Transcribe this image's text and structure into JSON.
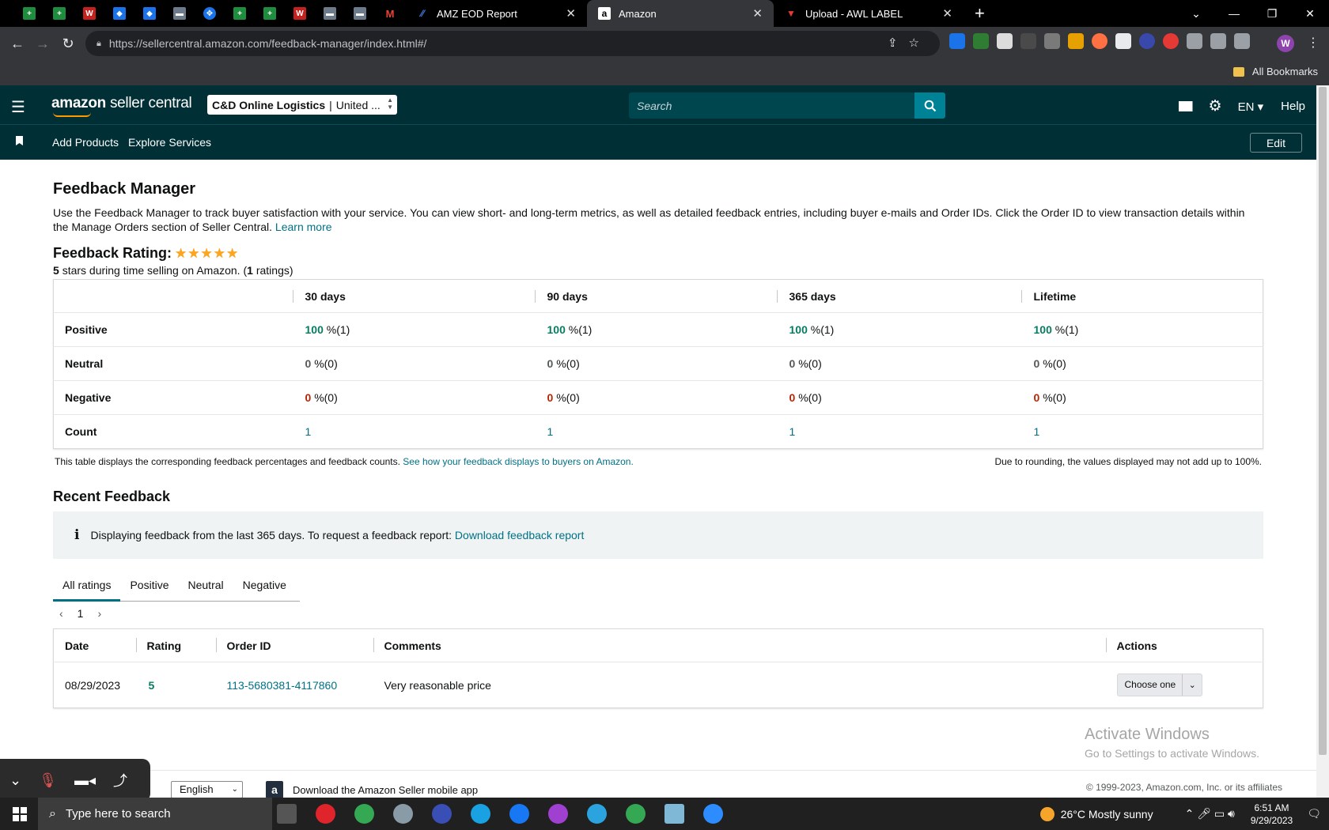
{
  "browser": {
    "tabs": [
      {
        "title": "AMZ EOD Report",
        "active": false
      },
      {
        "title": "Amazon",
        "active": true
      },
      {
        "title": "Upload - AWL LABEL",
        "active": false
      }
    ],
    "url_host": "https://sellercentral.amazon.com",
    "url_path": "/feedback-manager/index.html#/",
    "bookmarks_label": "All Bookmarks",
    "profile_initial": "W"
  },
  "header": {
    "logo_amazon": "amazon",
    "logo_rest": "seller central",
    "account_name": "C&D Online Logistics",
    "account_sep": "|",
    "account_region": "United ...",
    "search_placeholder": "Search",
    "lang": "EN",
    "help": "Help"
  },
  "subnav": {
    "links": [
      "Add Products",
      "Explore Services"
    ],
    "edit": "Edit"
  },
  "page": {
    "title": "Feedback Manager",
    "intro": "Use the Feedback Manager to track buyer satisfaction with your service. You can view short- and long-term metrics, as well as detailed feedback entries, including buyer e-mails and Order IDs. Click the Order ID to view transaction details within the Manage Orders section of Seller Central.",
    "learn_more": "Learn more",
    "rating_title": "Feedback Rating:",
    "stars": "★★★★★",
    "rating_stars_value": "5",
    "rating_stars_text": "stars during time selling on Amazon. (",
    "rating_count": "1",
    "rating_count_suffix": "ratings)"
  },
  "metrics": {
    "columns": [
      "30 days",
      "90 days",
      "365 days",
      "Lifetime"
    ],
    "rows": [
      {
        "label": "Positive",
        "values": [
          "100",
          "100",
          "100",
          "100"
        ],
        "suffix": "%(1)"
      },
      {
        "label": "Neutral",
        "values": [
          "0",
          "0",
          "0",
          "0"
        ],
        "suffix": "%(0)"
      },
      {
        "label": "Negative",
        "values": [
          "0",
          "0",
          "0",
          "0"
        ],
        "suffix": "%(0)"
      },
      {
        "label": "Count",
        "values": [
          "1",
          "1",
          "1",
          "1"
        ],
        "suffix": ""
      }
    ],
    "foot_left": "This table displays the corresponding feedback percentages and feedback counts.",
    "foot_link": "See how your feedback displays to buyers on Amazon.",
    "foot_right": "Due to rounding, the values displayed may not add up to 100%."
  },
  "recent": {
    "title": "Recent Feedback",
    "info_icon": "i",
    "info_text": "Displaying feedback from the last 365 days. To request a feedback report:",
    "info_link": "Download feedback report",
    "tabs": [
      "All ratings",
      "Positive",
      "Neutral",
      "Negative"
    ],
    "page": "1",
    "columns": [
      "Date",
      "Rating",
      "Order ID",
      "Comments",
      "Actions"
    ],
    "rows": [
      {
        "date": "08/29/2023",
        "rating": "5",
        "order_id": "113-5680381-4117860",
        "comment": "Very reasonable price",
        "action": "Choose one"
      }
    ]
  },
  "overlay": {
    "activate_title": "Activate Windows",
    "activate_sub": "Go to Settings to activate Windows."
  },
  "footer": {
    "language": "English",
    "app_download": "Download the Amazon Seller mobile app",
    "copyright": "© 1999-2023, Amazon.com, Inc. or its affiliates"
  },
  "taskbar": {
    "search_placeholder": "Type here to search",
    "weather": "26°C  Mostly sunny",
    "time": "6:51 AM",
    "date": "9/29/2023"
  }
}
